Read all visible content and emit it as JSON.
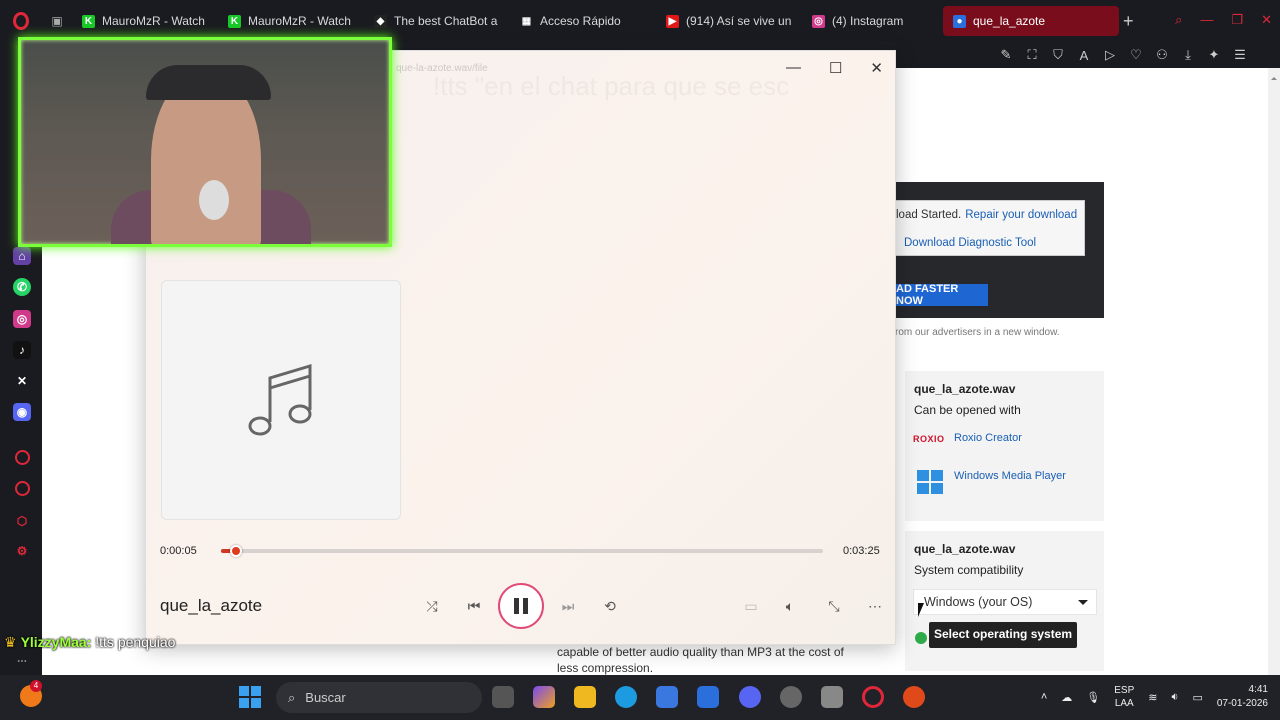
{
  "browser": {
    "tabs": [
      {
        "label": "MauroMzR - Watch",
        "fav_color": "#18c828",
        "fav_char": "K",
        "width": 142
      },
      {
        "label": "MauroMzR - Watch",
        "fav_color": "#18c828",
        "fav_char": "K",
        "width": 142
      },
      {
        "label": "The best ChatBot a",
        "fav_color": "#222222",
        "fav_char": "◆",
        "width": 142
      },
      {
        "label": "Acceso Rápido",
        "fav_color": "#1a1b20",
        "fav_char": "▦",
        "width": 142
      },
      {
        "label": "(914) Así se vive un",
        "fav_color": "#e01818",
        "fav_char": "▶",
        "width": 142
      },
      {
        "label": "(4) Instagram",
        "fav_color": "#d13a8a",
        "fav_char": "◎",
        "width": 137
      },
      {
        "label": "que_la_azote",
        "fav_color": "#2a6fdb",
        "fav_char": "●",
        "width": 176,
        "active": true
      }
    ],
    "add_tab": "+"
  },
  "page": {
    "notice_prefix": "load Started.",
    "repair_link": "Repair your download",
    "diagnostic_link": "Download Diagnostic Tool",
    "faster_button": "AD FASTER NOW",
    "advertisers_text": "rom our advertisers in a new window.",
    "card1": {
      "title": "que_la_azote.wav",
      "subtitle": "Can be opened with",
      "roxio_logo": "ROXIO",
      "roxio_link": "Roxio Creator",
      "wmp_link": "Windows Media Player"
    },
    "card2": {
      "title": "que_la_azote.wav",
      "subtitle": "System compatibility",
      "os_select": "Windows (your OS)",
      "tooltip": "Select operating system"
    },
    "body_text": "capable of better audio quality than MP3 at the cost of less compression."
  },
  "player": {
    "faint_path": "que-la-azote.wav/file",
    "overlay_caption": "!tts \"en el chat para que se esc",
    "elapsed": "0:00:05",
    "total": "0:03:25",
    "progress": 0.025,
    "song_title": "que_la_azote"
  },
  "chat": {
    "user": "YlizzyMaa:",
    "message": "!tts penquiao"
  },
  "taskbar": {
    "search_placeholder": "Buscar",
    "widget_badge": "4",
    "lang_line1": "ESP",
    "lang_line2": "LAA",
    "time": "4:41",
    "date": "07-01-2026"
  }
}
